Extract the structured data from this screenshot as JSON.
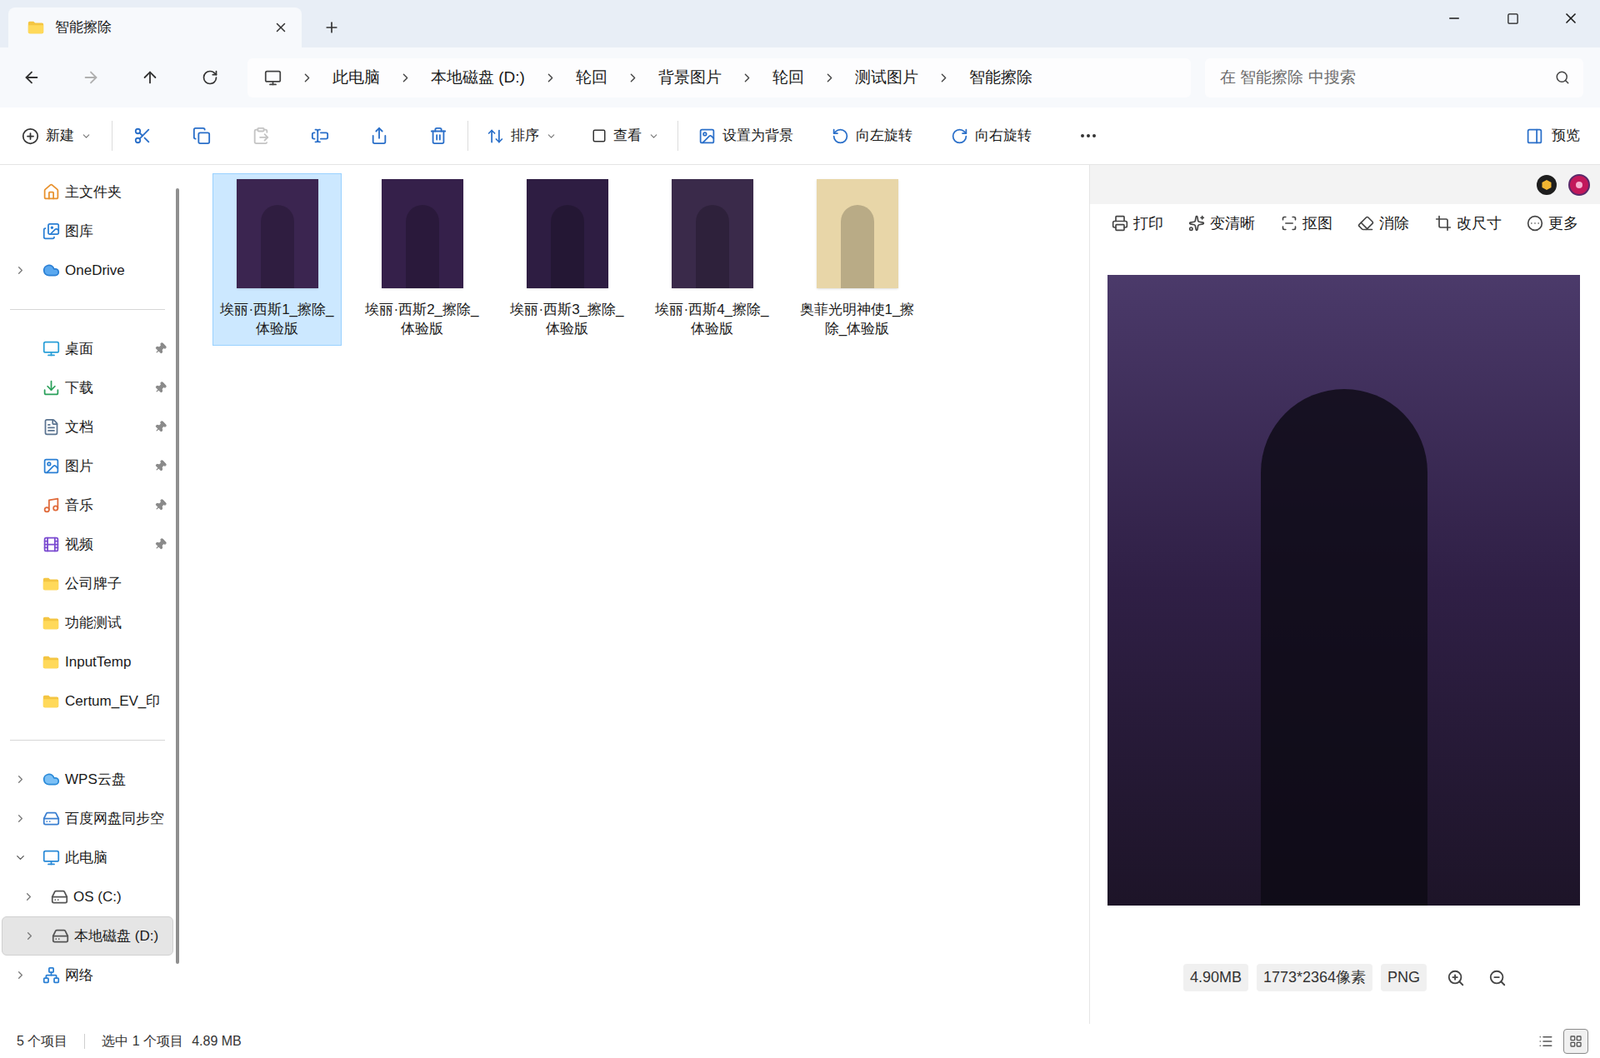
{
  "window": {
    "title": "智能擦除"
  },
  "nav": {
    "back_disabled": false,
    "forward_disabled": true
  },
  "breadcrumb": [
    "此电脑",
    "本地磁盘 (D:)",
    "轮回",
    "背景图片",
    "轮回",
    "测试图片",
    "智能擦除"
  ],
  "search": {
    "placeholder": "在 智能擦除 中搜索"
  },
  "toolbar": {
    "new": "新建",
    "edit_buttons": [
      {
        "disabled": false
      },
      {
        "disabled": false
      },
      {
        "disabled": true
      },
      {
        "disabled": false
      },
      {
        "disabled": false
      },
      {
        "disabled": false
      }
    ],
    "sort": "排序",
    "view": "查看",
    "actions": [
      "设置为背景",
      "向左旋转",
      "向右旋转"
    ],
    "preview": "预览"
  },
  "sidebar": {
    "groups": [
      [
        {
          "label": "主文件夹",
          "pinned": false,
          "expandable": false,
          "expanded": false,
          "selected": false,
          "depth": 0
        },
        {
          "label": "图库",
          "pinned": false,
          "expandable": false,
          "expanded": false,
          "selected": false,
          "depth": 0
        },
        {
          "label": "OneDrive",
          "pinned": false,
          "expandable": true,
          "expanded": false,
          "selected": false,
          "depth": 0
        }
      ],
      [
        {
          "label": "桌面",
          "pinned": true,
          "expandable": false,
          "expanded": false,
          "selected": false,
          "depth": 0
        },
        {
          "label": "下载",
          "pinned": true,
          "expandable": false,
          "expanded": false,
          "selected": false,
          "depth": 0
        },
        {
          "label": "文档",
          "pinned": true,
          "expandable": false,
          "expanded": false,
          "selected": false,
          "depth": 0
        },
        {
          "label": "图片",
          "pinned": true,
          "expandable": false,
          "expanded": false,
          "selected": false,
          "depth": 0
        },
        {
          "label": "音乐",
          "pinned": true,
          "expandable": false,
          "expanded": false,
          "selected": false,
          "depth": 0
        },
        {
          "label": "视频",
          "pinned": true,
          "expandable": false,
          "expanded": false,
          "selected": false,
          "depth": 0
        },
        {
          "label": "公司牌子",
          "pinned": false,
          "expandable": false,
          "expanded": false,
          "selected": false,
          "depth": 0
        },
        {
          "label": "功能测试",
          "pinned": false,
          "expandable": false,
          "expanded": false,
          "selected": false,
          "depth": 0
        },
        {
          "label": "InputTemp",
          "pinned": false,
          "expandable": false,
          "expanded": false,
          "selected": false,
          "depth": 0
        },
        {
          "label": "Certum_EV_印",
          "pinned": false,
          "expandable": false,
          "expanded": false,
          "selected": false,
          "depth": 0
        }
      ],
      [
        {
          "label": "WPS云盘",
          "pinned": false,
          "expandable": true,
          "expanded": false,
          "selected": false,
          "depth": 0
        },
        {
          "label": "百度网盘同步空",
          "pinned": false,
          "expandable": true,
          "expanded": false,
          "selected": false,
          "depth": 0
        },
        {
          "label": "此电脑",
          "pinned": false,
          "expandable": true,
          "expanded": true,
          "selected": false,
          "depth": 0
        },
        {
          "label": "OS (C:)",
          "pinned": false,
          "expandable": true,
          "expanded": false,
          "selected": false,
          "depth": 1
        },
        {
          "label": "本地磁盘 (D:)",
          "pinned": false,
          "expandable": true,
          "expanded": false,
          "selected": true,
          "depth": 1
        },
        {
          "label": "网络",
          "pinned": false,
          "expandable": true,
          "expanded": false,
          "selected": false,
          "depth": 0
        }
      ]
    ]
  },
  "files": [
    {
      "name": "埃丽·西斯1_擦除_体验版",
      "selected": true,
      "color": "#3b2550"
    },
    {
      "name": "埃丽·西斯2_擦除_体验版",
      "selected": false,
      "color": "#35204a"
    },
    {
      "name": "埃丽·西斯3_擦除_体验版",
      "selected": false,
      "color": "#2e1d42"
    },
    {
      "name": "埃丽·西斯4_擦除_体验版",
      "selected": false,
      "color": "#3a2a4a"
    },
    {
      "name": "奥菲光明神使1_擦除_体验版",
      "selected": false,
      "color": "#e8d6a8"
    }
  ],
  "preview": {
    "actions": [
      "打印",
      "变清晰",
      "抠图",
      "消除",
      "改尺寸",
      "更多"
    ],
    "size": "4.90MB",
    "dimensions": "1773*2364像素",
    "format": "PNG"
  },
  "status_bar": {
    "count": "5 个项目",
    "selection": "选中 1 个项目",
    "size": "4.89 MB",
    "views": [
      {
        "selected": false
      },
      {
        "selected": true
      }
    ]
  }
}
